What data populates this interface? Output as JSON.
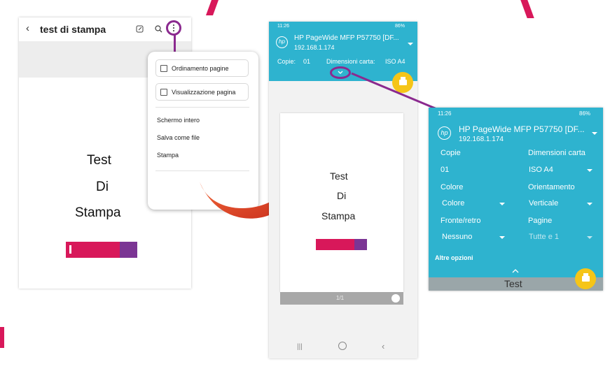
{
  "colors": {
    "teal": "#2eb3cf",
    "yellow": "#f5c518",
    "accent_purple": "#8b2a8f",
    "arrow_red": "#e8452a",
    "logo_pink": "#d8185a"
  },
  "notes_screen": {
    "title": "test di stampa",
    "icons": [
      "back-icon",
      "edit-icon",
      "search-icon",
      "more-vert-icon"
    ],
    "doc_lines": [
      "Test",
      "Di",
      "Stampa"
    ]
  },
  "menu": {
    "page_order": "Ordinamento pagine",
    "page_view": "Visualizzazione pagina",
    "fullscreen": "Schermo intero",
    "save_as_file": "Salva come file",
    "print": "Stampa"
  },
  "print_screen": {
    "time": "11:26",
    "battery": "86%",
    "printer_name": "HP PageWide MFP P57750 [DF...",
    "ip": "192.168.1.174",
    "copies_label": "Copie:",
    "copies_value": "01",
    "paper_label": "Dimensioni carta:",
    "paper_value": "ISO A4",
    "preview_lines": [
      "Test",
      "Di",
      "Stampa"
    ],
    "page_counter": "1/1",
    "nav_icons": [
      "recents-icon",
      "home-icon",
      "back-icon"
    ]
  },
  "options_panel": {
    "time": "11:26",
    "battery": "86%",
    "printer_name": "HP PageWide MFP P57750 [DF...",
    "ip": "192.168.1.174",
    "copies_label": "Copie",
    "copies_value": "01",
    "paper_label": "Dimensioni carta",
    "paper_value": "ISO A4",
    "color_label": "Colore",
    "color_value": "Colore",
    "orientation_label": "Orientamento",
    "orientation_value": "Verticale",
    "duplex_label": "Fronte/retro",
    "duplex_value": "Nessuno",
    "pages_label": "Pagine",
    "pages_value": "Tutte e 1",
    "more_options": "Altre opzioni",
    "peek_text": "Test"
  }
}
